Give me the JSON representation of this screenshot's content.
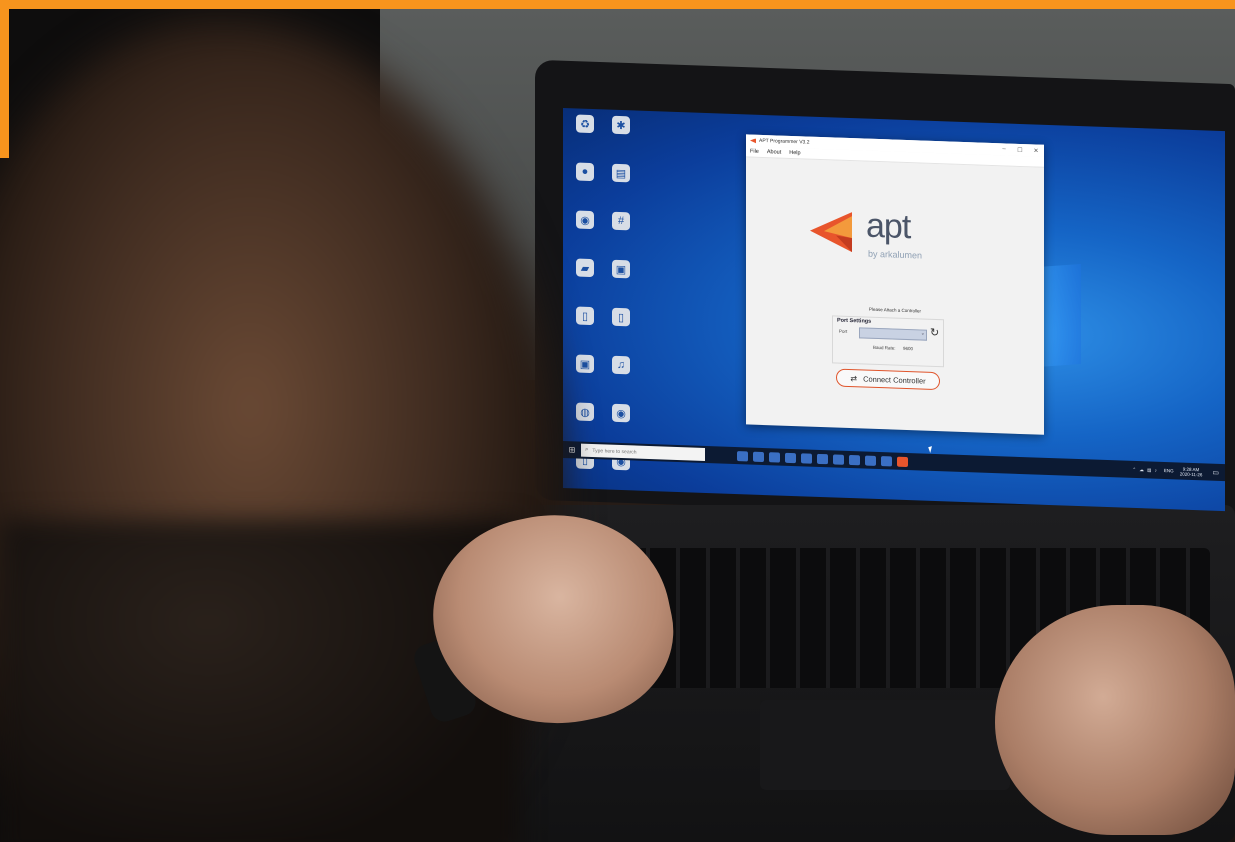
{
  "window": {
    "title": "APT Programmer V3.2",
    "controls": [
      "–",
      "☐",
      "✕"
    ]
  },
  "menu": {
    "file": "File",
    "about": "About",
    "help": "Help"
  },
  "logo": {
    "text": "apt",
    "subtitle": "by arkalumen"
  },
  "status": {
    "message": "Please Attach a Controller"
  },
  "port_settings": {
    "title": "Port Settings",
    "port_label": "Port",
    "port_value": "",
    "baud_label": "Baud Rate:",
    "baud_value": "9600"
  },
  "connect": {
    "label": "Connect Controller"
  },
  "taskbar": {
    "search_placeholder": "Type here to search",
    "tray_lang": "ENG",
    "clock_time": "9:28 AM",
    "clock_date": "2020-11-26"
  },
  "colors": {
    "brand_orange": "#e8552c",
    "frame_orange": "#f7941d",
    "desktop_blue": "#1565c6"
  },
  "icons": {
    "refresh": "refresh-icon",
    "connect": "connect-arrows-icon",
    "start": "windows-start-icon",
    "search": "search-icon"
  }
}
